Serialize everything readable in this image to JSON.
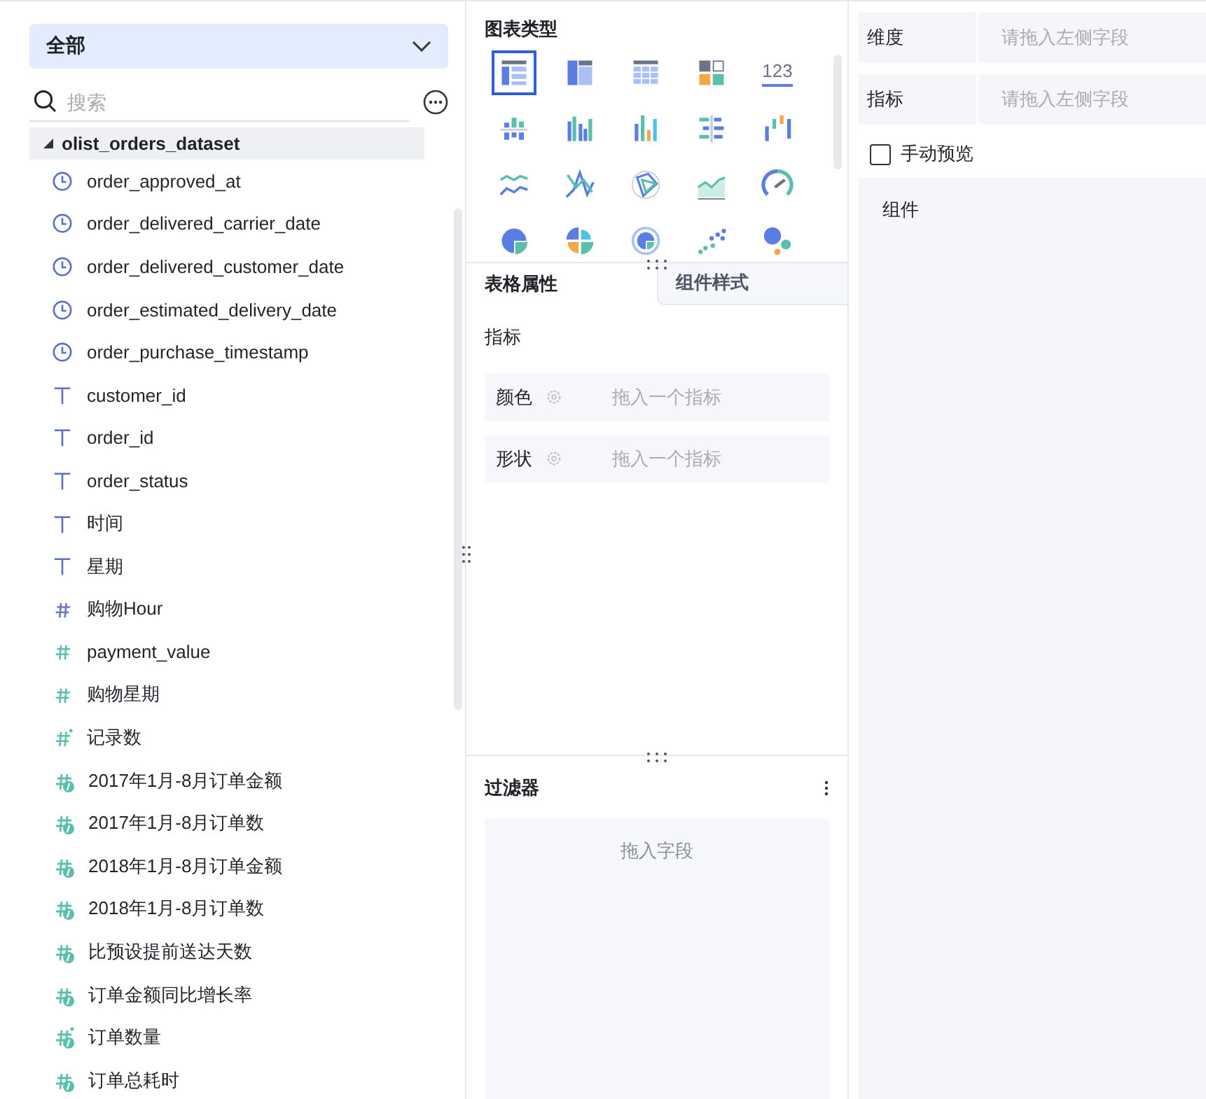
{
  "field_panel": {
    "scope_select": {
      "value": "全部"
    },
    "search": {
      "placeholder": "搜索"
    },
    "tree": [
      {
        "name": "olist_orders_dataset",
        "expanded": true,
        "children": [
          {
            "name": "order_approved_at",
            "kind": "date"
          },
          {
            "name": "order_delivered_carrier_date",
            "kind": "date"
          },
          {
            "name": "order_delivered_customer_date",
            "kind": "date"
          },
          {
            "name": "order_estimated_delivery_date",
            "kind": "date"
          },
          {
            "name": "order_purchase_timestamp",
            "kind": "date"
          },
          {
            "name": "customer_id",
            "kind": "text"
          },
          {
            "name": "order_id",
            "kind": "text"
          },
          {
            "name": "order_status",
            "kind": "text"
          },
          {
            "name": "时间",
            "kind": "text"
          },
          {
            "name": "星期",
            "kind": "text"
          },
          {
            "name": "购物Hour",
            "kind": "number-dim"
          },
          {
            "name": "payment_value",
            "kind": "number"
          },
          {
            "name": "购物星期",
            "kind": "number"
          },
          {
            "name": "记录数",
            "kind": "count"
          },
          {
            "name": "2017年1月-8月订单金额",
            "kind": "calc"
          },
          {
            "name": "2017年1月-8月订单数",
            "kind": "calc"
          },
          {
            "name": "2018年1月-8月订单金额",
            "kind": "calc"
          },
          {
            "name": "2018年1月-8月订单数",
            "kind": "calc"
          },
          {
            "name": "比预设提前送达天数",
            "kind": "calc"
          },
          {
            "name": "订单金额同比增长率",
            "kind": "calc"
          },
          {
            "name": "订单数量",
            "kind": "calc-count"
          },
          {
            "name": "订单总耗时",
            "kind": "calc"
          }
        ]
      }
    ]
  },
  "chart_panel": {
    "title": "图表类型",
    "chart_types": [
      {
        "kind": "table",
        "selected": true
      },
      {
        "kind": "pivot",
        "selected": false
      },
      {
        "kind": "detail",
        "selected": false
      },
      {
        "kind": "card",
        "selected": false
      },
      {
        "kind": "number",
        "text": "123",
        "selected": false
      },
      {
        "kind": "stacked-column",
        "selected": false
      },
      {
        "kind": "grouped-column",
        "selected": false
      },
      {
        "kind": "column",
        "selected": false
      },
      {
        "kind": "bar",
        "selected": false
      },
      {
        "kind": "waterfall",
        "selected": false
      },
      {
        "kind": "line",
        "selected": false
      },
      {
        "kind": "multi-line",
        "selected": false
      },
      {
        "kind": "radar",
        "selected": false
      },
      {
        "kind": "area",
        "selected": false
      },
      {
        "kind": "gauge",
        "selected": false
      },
      {
        "kind": "pie",
        "selected": false
      },
      {
        "kind": "rose",
        "selected": false
      },
      {
        "kind": "ring",
        "selected": false
      },
      {
        "kind": "scatter",
        "selected": false
      },
      {
        "kind": "bubble",
        "selected": false
      }
    ],
    "tabs": [
      {
        "label": "表格属性",
        "selected": true
      },
      {
        "label": "组件样式",
        "selected": false
      }
    ],
    "section_label": "指标",
    "slots": [
      {
        "label": "颜色",
        "placeholder": "拖入一个指标"
      },
      {
        "label": "形状",
        "placeholder": "拖入一个指标"
      }
    ],
    "filter": {
      "title": "过滤器",
      "placeholder": "拖入字段"
    }
  },
  "config_panel": {
    "rows": [
      {
        "label": "维度",
        "placeholder": "请拖入左侧字段"
      },
      {
        "label": "指标",
        "placeholder": "请拖入左侧字段"
      }
    ],
    "manual_preview": {
      "label": "手动预览",
      "checked": false
    },
    "component": {
      "label": "组件"
    }
  }
}
